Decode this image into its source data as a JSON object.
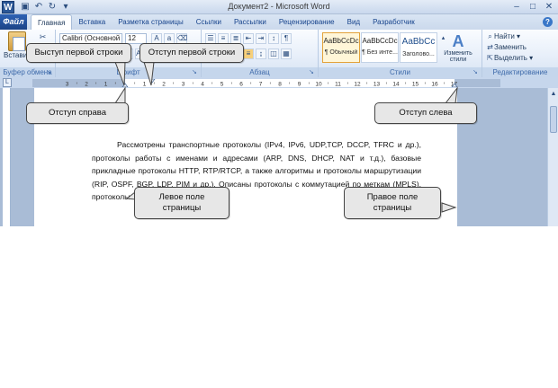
{
  "app": {
    "logo_letter": "W",
    "title": "Документ2 - Microsoft Word",
    "qat_icons": [
      "save-icon",
      "undo-icon",
      "redo-icon",
      "customize-icon"
    ],
    "window_buttons": [
      "–",
      "□",
      "✕"
    ]
  },
  "tabs": {
    "office_button": "Файл",
    "items": [
      "Главная",
      "Вставка",
      "Разметка страницы",
      "Ссылки",
      "Рассылки",
      "Рецензирование",
      "Вид",
      "Разработчик"
    ],
    "active": "Главная",
    "help": "?"
  },
  "ribbon": {
    "clipboard": {
      "label": "Буфер обмена",
      "paste_label": "Вставить"
    },
    "font": {
      "label": "Шрифт",
      "font_name": "Calibri (Основной те",
      "font_size": "12"
    },
    "paragraph": {
      "label": "Абзац"
    },
    "styles": {
      "label": "Стили",
      "items": [
        {
          "sample": "AaBbCcDc",
          "name": "¶ Обычный",
          "selected": true
        },
        {
          "sample": "AaBbCcDc",
          "name": "¶ Без инте...",
          "selected": false
        },
        {
          "sample": "AaBbCc",
          "name": "Заголово...",
          "selected": false
        }
      ],
      "change_styles": "Изменить стили"
    },
    "editing": {
      "label": "Редактирование",
      "find": "Найти",
      "replace": "Заменить",
      "select": "Выделить"
    }
  },
  "ruler": {
    "left_numbers": [
      "3",
      "2",
      "1"
    ],
    "right_numbers": [
      "1",
      "2",
      "3",
      "4",
      "5",
      "6",
      "7",
      "8",
      "9",
      "10",
      "11",
      "12",
      "13",
      "14",
      "15",
      "16",
      "17"
    ]
  },
  "document": {
    "paragraph": "Рассмотрены транспортные протоколы (IPv4, IPv6, UDP,TCP, DCCP, TFRC и др.), протоколы работы с именами и адресами (ARP, DNS, DHCP, NAT и т.д.), базовые прикладные протоколы HTTP, RTP/RTCP, а также алгоритмы и протоколы маршрутизации (RIP, OSPF, BGP, LDP, PIM и др.). Описаны протоколы с коммутацией по меткам (MPLS), протоколы сетевой безопасности."
  },
  "callouts": {
    "first_line_outdent": "Выступ первой строки",
    "first_line_indent": "Отступ первой строки",
    "right_indent": "Отступ справа",
    "left_indent": "Отступ слева",
    "left_margin": "Левое поле страницы",
    "right_margin": "Правое поле страницы"
  }
}
